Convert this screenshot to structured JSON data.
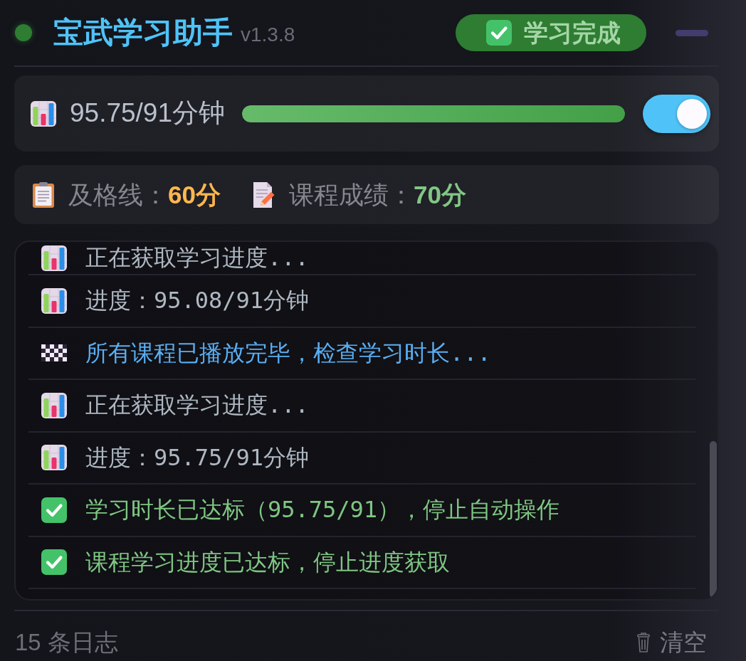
{
  "header": {
    "status_on": true,
    "title": "宝武学习助手",
    "version": "v1.3.8",
    "badge": {
      "kind": "success",
      "label": "学习完成"
    }
  },
  "progress": {
    "reading": "95.75/91分钟",
    "level": 1,
    "auto_on": true
  },
  "scores": [
    {
      "kind": "pass_line",
      "label": "及格线：",
      "value": "60分"
    },
    {
      "kind": "course_score",
      "label": "课程成绩：",
      "value": "70分"
    }
  ],
  "log": {
    "entries": [
      {
        "kind": "progress",
        "text": "正在获取学习进度..."
      },
      {
        "kind": "progress",
        "text": "进度：95.08/91分钟"
      },
      {
        "kind": "info",
        "text": "所有课程已播放完毕，检查学习时长..."
      },
      {
        "kind": "progress",
        "text": "正在获取学习进度..."
      },
      {
        "kind": "progress",
        "text": "进度：95.75/91分钟"
      },
      {
        "kind": "success",
        "text": "学习时长已达标（95.75/91），停止自动操作"
      },
      {
        "kind": "success",
        "text": "课程学习进度已达标，停止进度获取"
      }
    ]
  },
  "footer": {
    "count": "15 条日志",
    "clear": "清空"
  }
}
